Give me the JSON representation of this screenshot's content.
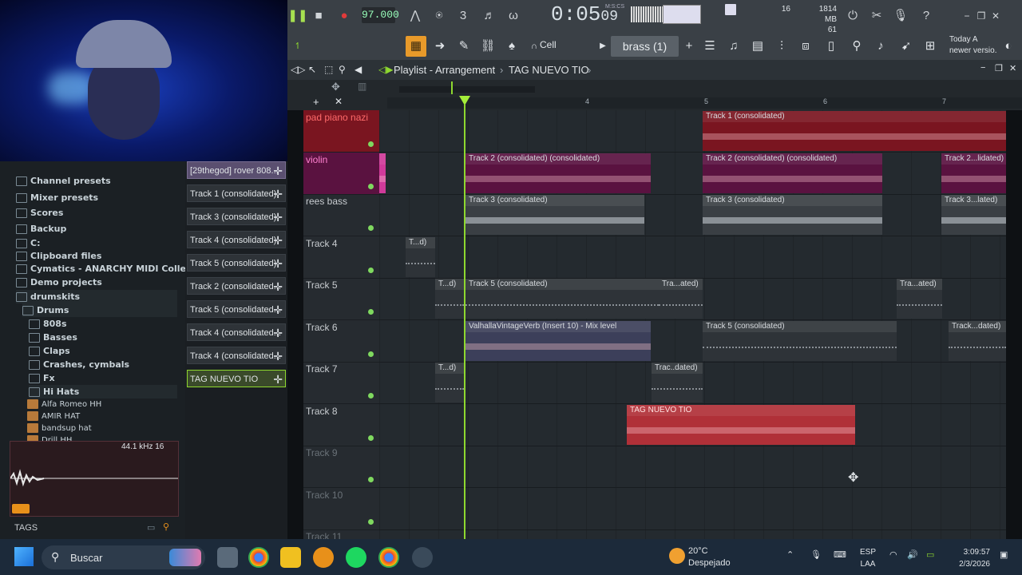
{
  "transport": {
    "tempo": "97.000",
    "time": "0:05",
    "time_sub": "09",
    "time_unit": "M:S:CS",
    "cpu_top": "16",
    "mem": "1814 MB",
    "mem_sub": "61"
  },
  "toolbar2": {
    "snap": "Cell",
    "pattern": "brass (1)",
    "news_line1": "Today  A",
    "news_line2": "newer versio."
  },
  "browser": {
    "items": [
      {
        "label": "Channel presets",
        "level": 0,
        "type": "folder"
      },
      {
        "label": "Mixer presets",
        "level": 0,
        "type": "folder"
      },
      {
        "label": "Scores",
        "level": 0,
        "type": "folder"
      },
      {
        "label": "Backup",
        "level": 0,
        "type": "folder"
      },
      {
        "label": "C:",
        "level": 0,
        "type": "folder"
      },
      {
        "label": "Clipboard files",
        "level": 0,
        "type": "folder"
      },
      {
        "label": "Cymatics - ANARCHY MIDI Collection",
        "level": 0,
        "type": "folder"
      },
      {
        "label": "Demo projects",
        "level": 0,
        "type": "folder"
      },
      {
        "label": "drumskits",
        "level": 0,
        "type": "folder"
      },
      {
        "label": "Drums",
        "level": 1,
        "type": "folder"
      },
      {
        "label": "808s",
        "level": 2,
        "type": "folder"
      },
      {
        "label": "Basses",
        "level": 2,
        "type": "folder"
      },
      {
        "label": "Claps",
        "level": 2,
        "type": "folder"
      },
      {
        "label": "Crashes, cymbals",
        "level": 2,
        "type": "folder"
      },
      {
        "label": "Fx",
        "level": 2,
        "type": "folder"
      },
      {
        "label": "Hi Hats",
        "level": 2,
        "type": "folder"
      },
      {
        "label": "Alfa Romeo HH",
        "level": 3,
        "type": "file"
      },
      {
        "label": "AMIR HAT",
        "level": 3,
        "type": "file"
      },
      {
        "label": "bandsup hat",
        "level": 3,
        "type": "file"
      },
      {
        "label": "Drill HH",
        "level": 3,
        "type": "file"
      }
    ],
    "sample_info": "44.1 kHz 16",
    "tags_label": "TAGS"
  },
  "picker": {
    "items": [
      "[29thegod] rover 808...",
      "Track 1 (consolidated)",
      "Track 3 (consolidated)",
      "Track 4 (consolidated)",
      "Track 5 (consolidated)",
      "Track 2 (consolidated...",
      "Track 5 (consolidated...",
      "Track 4 (consolidated...",
      "Track 4 (consolidated...",
      "TAG NUEVO TIO"
    ]
  },
  "playlist": {
    "title": "Playlist - Arrangement",
    "arrangement": "TAG NUEVO TIO",
    "ruler": [
      "4",
      "5",
      "6",
      "7"
    ],
    "tracks": [
      "pad piano nazi",
      "violin",
      "rees bass",
      "Track 4",
      "Track 5",
      "Track 6",
      "Track 7",
      "Track 8",
      "Track 9",
      "Track 10",
      "Track 11"
    ],
    "clips": [
      {
        "track": 0,
        "label": "Track 1 (consolidated)",
        "color": "#7a1520",
        "start": 405,
        "end": 785
      },
      {
        "track": 1,
        "label": "Track 2 (consolidated) (consolidated)",
        "color": "#5a1240",
        "start": 108,
        "end": 340
      },
      {
        "track": 1,
        "label": "Track 2 (consolidated) (consolidated)",
        "color": "#5a1240",
        "start": 405,
        "end": 630
      },
      {
        "track": 1,
        "label": "Track 2...lidated)",
        "color": "#5a1240",
        "start": 704,
        "end": 785
      },
      {
        "track": 1,
        "label": "",
        "color": "#d03a9a",
        "start": 0,
        "end": 8
      },
      {
        "track": 2,
        "label": "Track 3 (consolidated)",
        "color": "#3a3f44",
        "start": 108,
        "end": 332
      },
      {
        "track": 2,
        "label": "Track 3 (consolidated)",
        "color": "#3a3f44",
        "start": 405,
        "end": 630
      },
      {
        "track": 2,
        "label": "Track 3...lated)",
        "color": "#3a3f44",
        "start": 704,
        "end": 785
      },
      {
        "track": 3,
        "label": "T...d)",
        "color": "#2e3338",
        "start": 33,
        "end": 70
      },
      {
        "track": 4,
        "label": "T...d)",
        "color": "#2e3338",
        "start": 70,
        "end": 106
      },
      {
        "track": 4,
        "label": "Track 5 (consolidated)",
        "color": "#2e3338",
        "start": 108,
        "end": 350
      },
      {
        "track": 4,
        "label": "Tra...ated)",
        "color": "#2e3338",
        "start": 350,
        "end": 405
      },
      {
        "track": 4,
        "label": "Tra...ated)",
        "color": "#2e3338",
        "start": 648,
        "end": 705
      },
      {
        "track": 5,
        "label": "ValhallaVintageVerb (Insert 10) - Mix level",
        "color": "#3c3f5a",
        "start": 108,
        "end": 340
      },
      {
        "track": 5,
        "label": "Track 5 (consolidated)",
        "color": "#2e3338",
        "start": 405,
        "end": 648
      },
      {
        "track": 5,
        "label": "Track...dated)",
        "color": "#2e3338",
        "start": 713,
        "end": 785
      },
      {
        "track": 6,
        "label": "T...d)",
        "color": "#2e3338",
        "start": 70,
        "end": 106
      },
      {
        "track": 6,
        "label": "Trac..dated)",
        "color": "#2e3338",
        "start": 341,
        "end": 405
      },
      {
        "track": 7,
        "label": "TAG NUEVO TIO",
        "color": "#b03038",
        "start": 310,
        "end": 596
      }
    ]
  },
  "taskbar": {
    "search": "Buscar",
    "temp": "20°C",
    "weather": "Despejado",
    "lang": "ESP",
    "lang2": "LAA",
    "clock": "3:09:57",
    "date": "2/3/2026"
  }
}
